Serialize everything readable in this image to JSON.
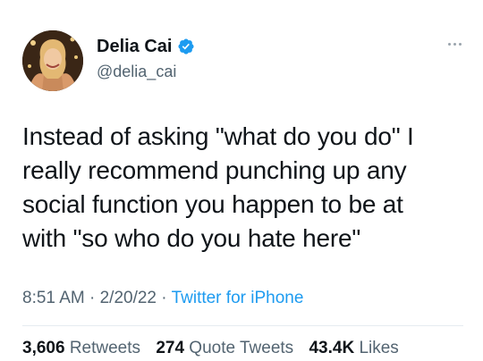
{
  "author": {
    "display_name": "Delia Cai",
    "handle": "@delia_cai",
    "verified": true
  },
  "tweet": {
    "lines": [
      "Instead of asking \"what do you do\" I",
      "really recommend punching up any",
      "social function you happen to be at",
      "with \"so who do you hate here\""
    ],
    "time": "8:51 AM",
    "separator": "·",
    "date": "2/20/22",
    "source": "Twitter for iPhone"
  },
  "stats": {
    "retweets_count": "3,606",
    "retweets_label": "Retweets",
    "quotes_count": "274",
    "quotes_label": "Quote Tweets",
    "likes_count": "43.4K",
    "likes_label": "Likes"
  },
  "icons": {
    "verified": "verified-badge-icon",
    "more": "more-dots-icon"
  },
  "colors": {
    "accent": "#1d9bf0",
    "text": "#0f1419",
    "secondary": "#536471"
  }
}
